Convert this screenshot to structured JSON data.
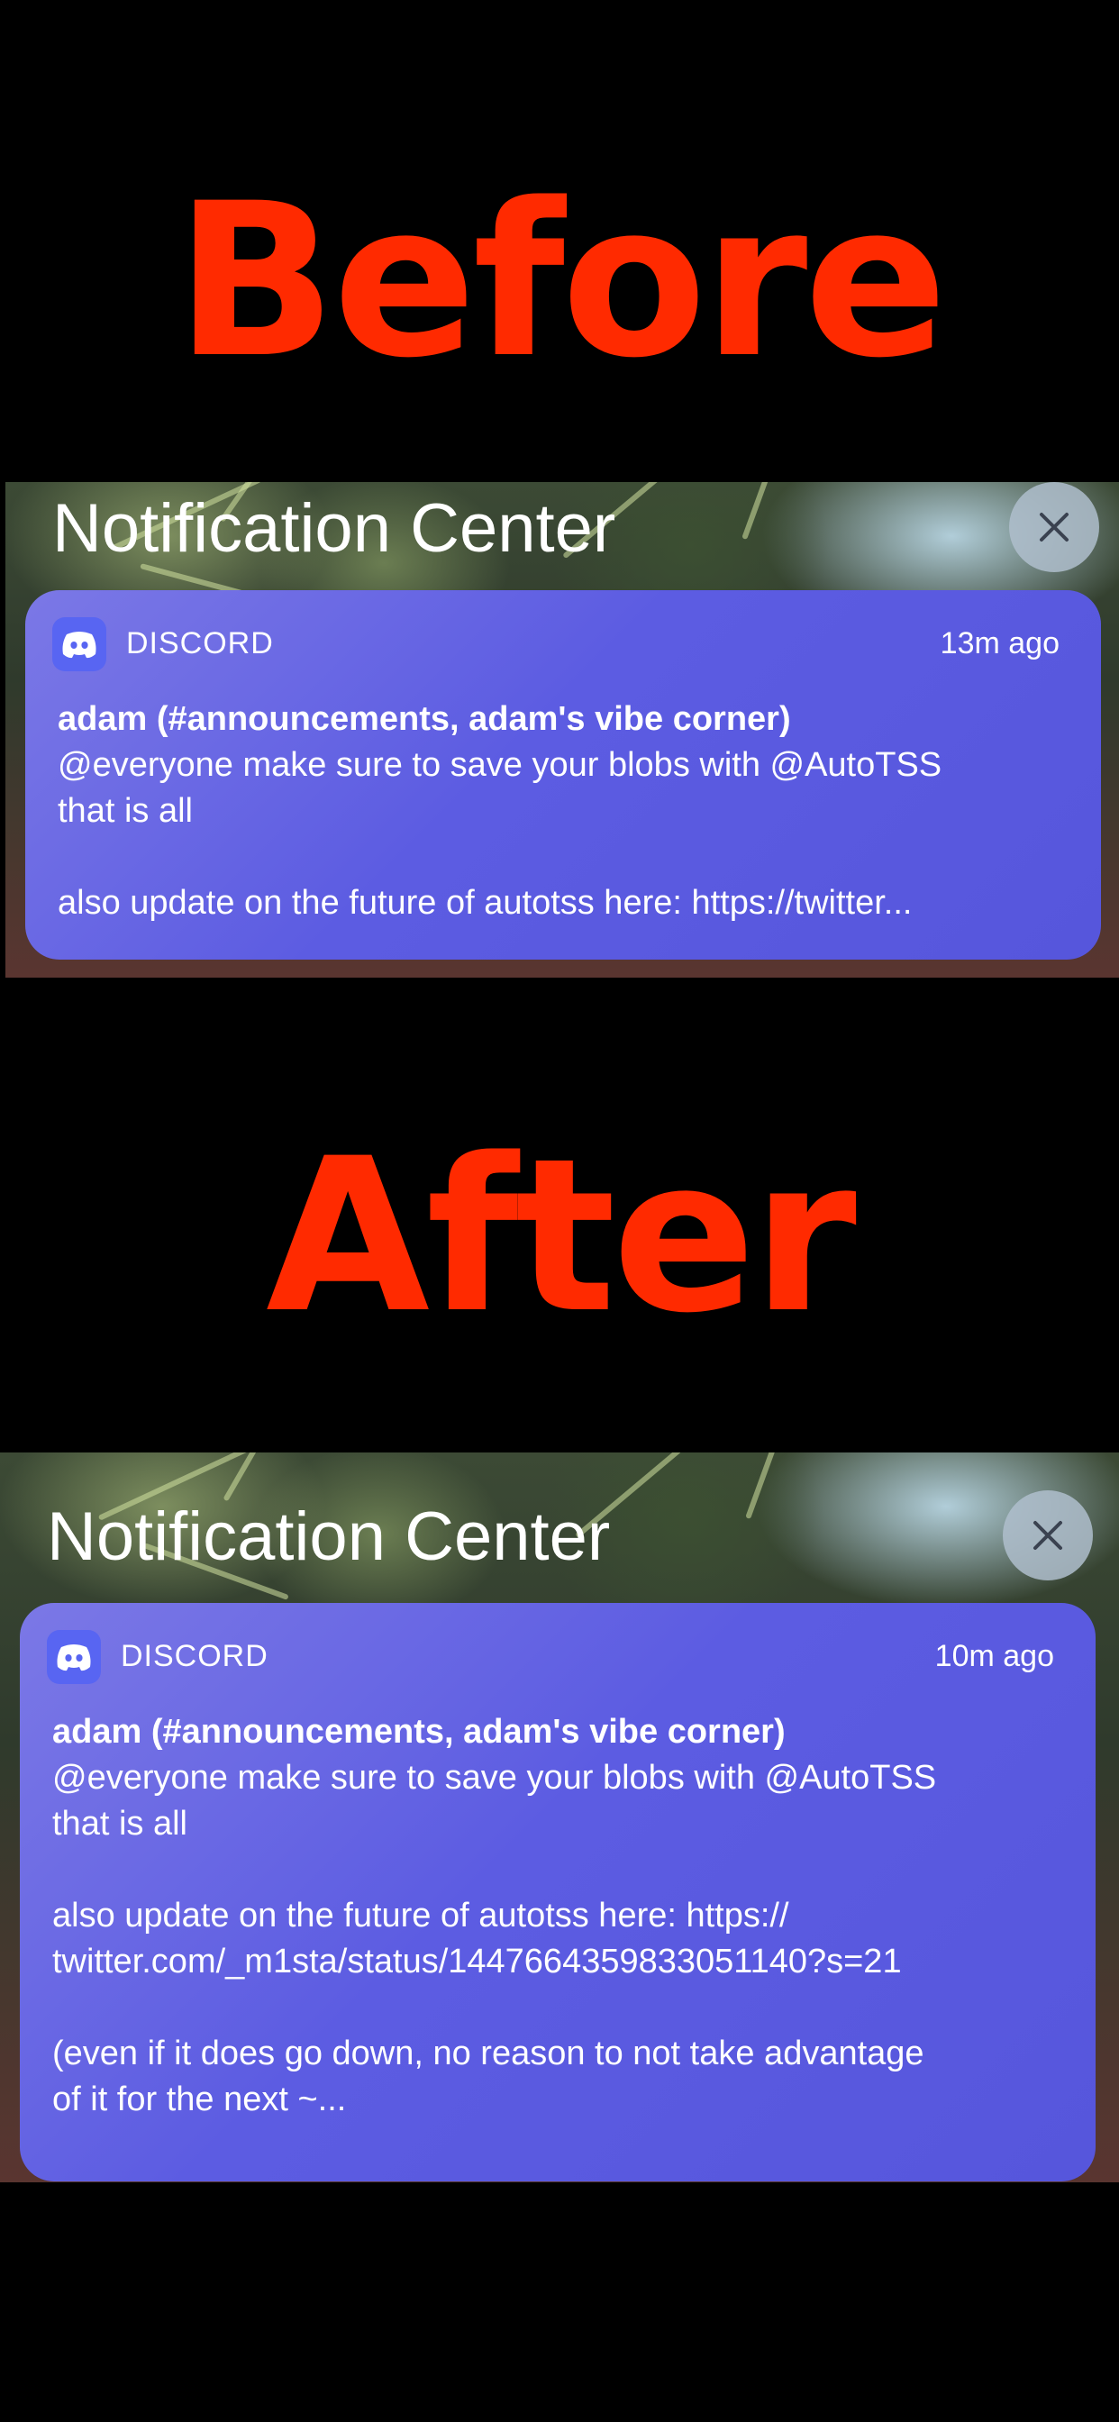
{
  "before": {
    "heading": "Before",
    "nc_title": "Notification Center",
    "notification": {
      "app": "DISCORD",
      "time": "13m ago",
      "sender": "adam (#announcements, adam's vibe corner)",
      "body": "@everyone make sure to save your blobs with @AutoTSS\nthat is all\n\nalso update on the future of autotss here: https://twitter..."
    }
  },
  "after": {
    "heading": "After",
    "nc_title": "Notification Center",
    "notification": {
      "app": "DISCORD",
      "time": "10m ago",
      "sender": "adam (#announcements, adam's vibe corner)",
      "body": "@everyone make sure to save your blobs with @AutoTSS\nthat is all\n\nalso update on the future of autotss here: https://\ntwitter.com/_m1sta/status/1447664359833051140?s=21\n\n(even if it does go down, no reason to not take advantage\nof it for the next ~..."
    }
  },
  "colors": {
    "heading": "#ff2a00",
    "card": "#5c5ce2",
    "discord_icon": "#5865f2"
  },
  "icons": {
    "close": "close-icon",
    "app": "discord-icon"
  }
}
